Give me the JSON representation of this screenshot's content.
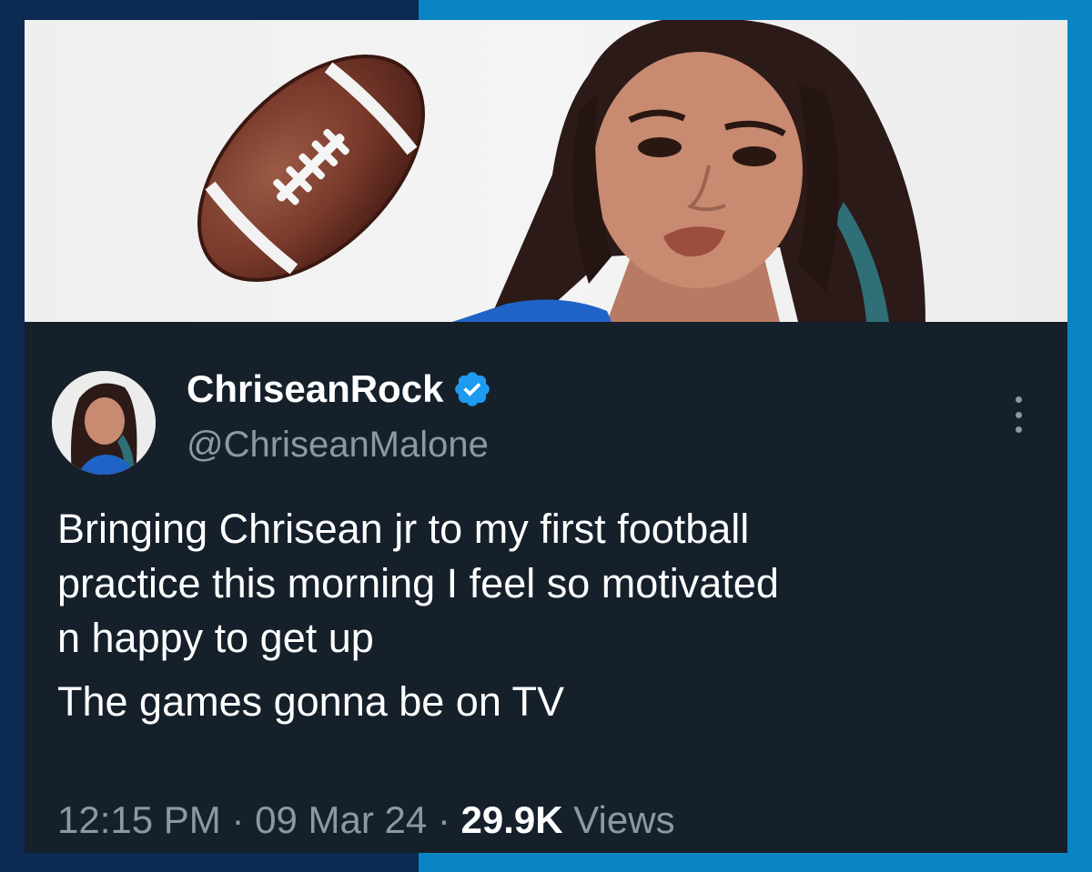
{
  "tweet": {
    "display_name": "ChriseanRock",
    "handle": "@ChriseanMalone",
    "verified": true,
    "verified_icon": "verified-badge-icon",
    "more_icon": "more-options-icon",
    "body_lines": [
      "Bringing Chrisean jr to my first football",
      "practice this morning I feel so motivated",
      "n happy to get up"
    ],
    "body_line2": "The games gonna be on TV",
    "time": "12:15 PM",
    "separator": " · ",
    "date": "09 Mar 24",
    "views_count": "29.9K",
    "views_label": "Views"
  },
  "banner": {
    "football_icon": "football-emoji-icon",
    "photo": "portrait-photo"
  },
  "colors": {
    "card_bg": "#15202b",
    "secondary_text": "#8b98a5",
    "verified_blue": "#1d9bf0",
    "frame_left": "#0d2a52",
    "frame_right": "#0a85c4"
  }
}
